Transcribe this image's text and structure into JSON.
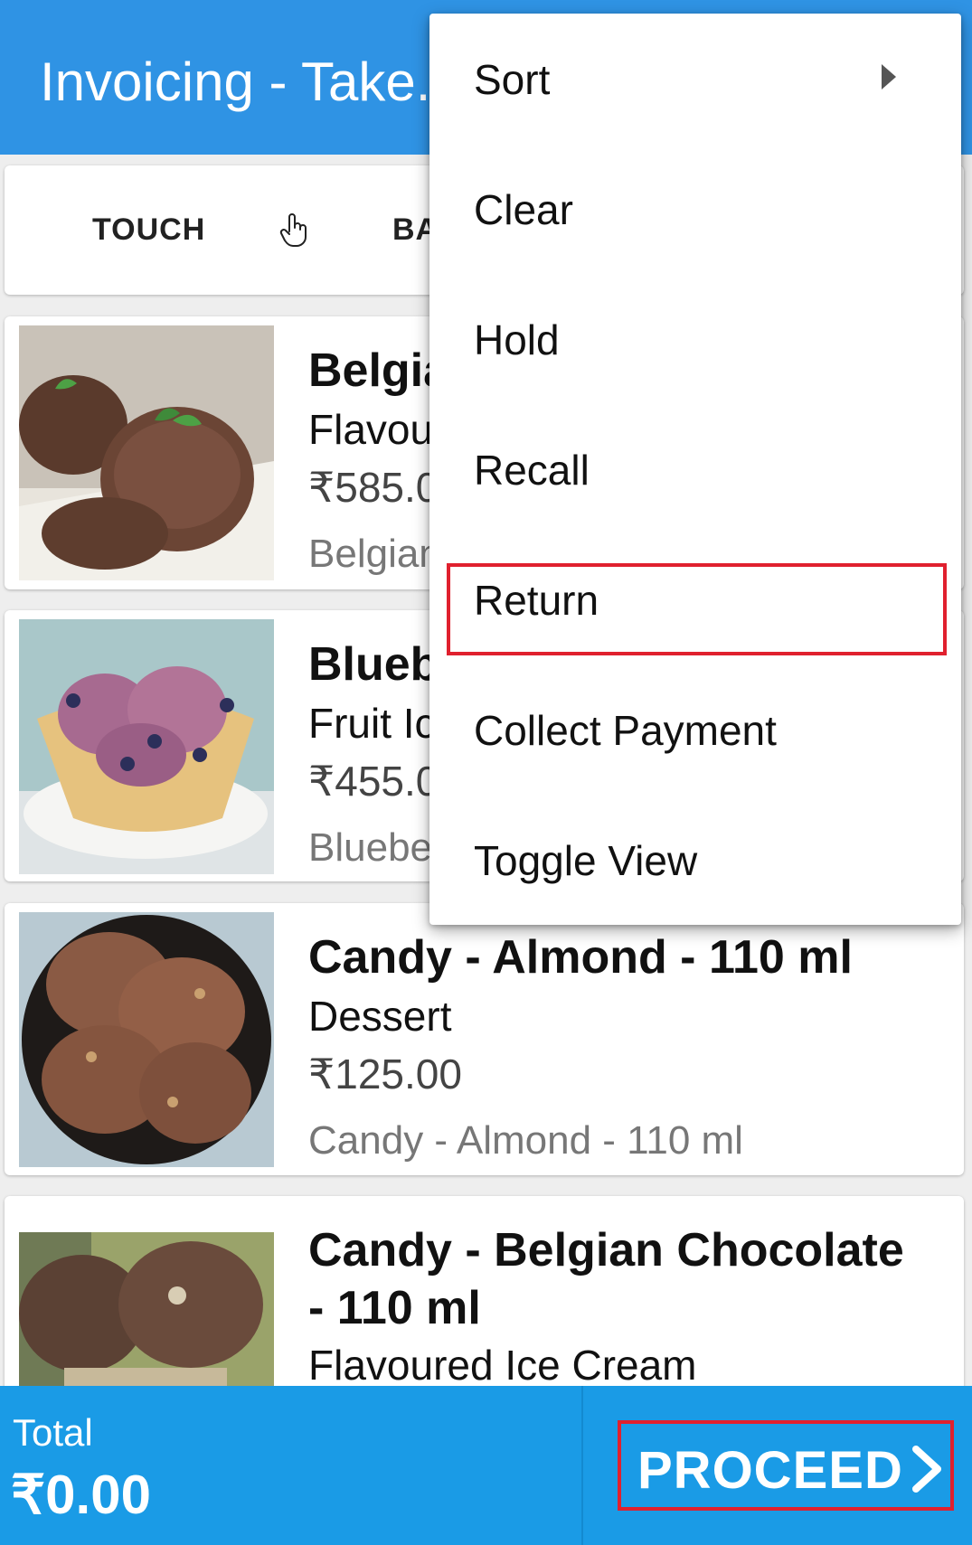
{
  "appbar": {
    "title": "Invoicing - Take..."
  },
  "modes": {
    "touch": "TOUCH",
    "barcode": "BA",
    "touch_icon": "pointer-hand-icon"
  },
  "products": [
    {
      "name": "Belgia",
      "category": "Flavour",
      "price": "₹585.0",
      "subtitle": "Belgian"
    },
    {
      "name": "Bluebe",
      "category": "Fruit Ic",
      "price": "₹455.0",
      "subtitle": "Blueber"
    },
    {
      "name": "Candy - Almond - 110 ml",
      "category": "Dessert",
      "price": "₹125.00",
      "subtitle": "Candy - Almond - 110 ml"
    },
    {
      "name": "Candy - Belgian Chocolate - 110 ml",
      "category": "Flavoured Ice Cream",
      "price": "",
      "subtitle": ""
    }
  ],
  "menu": {
    "items": [
      {
        "label": "Sort",
        "has_submenu": true
      },
      {
        "label": "Clear"
      },
      {
        "label": "Hold"
      },
      {
        "label": "Recall"
      },
      {
        "label": "Return",
        "highlighted": true
      },
      {
        "label": "Collect Payment"
      },
      {
        "label": "Toggle View"
      }
    ]
  },
  "footer": {
    "total_label": "Total",
    "total_value": "₹0.00",
    "proceed_label": "PROCEED"
  },
  "colors": {
    "primary": "#2f93e4",
    "footer": "#1a9be6",
    "highlight": "#e0202e"
  }
}
